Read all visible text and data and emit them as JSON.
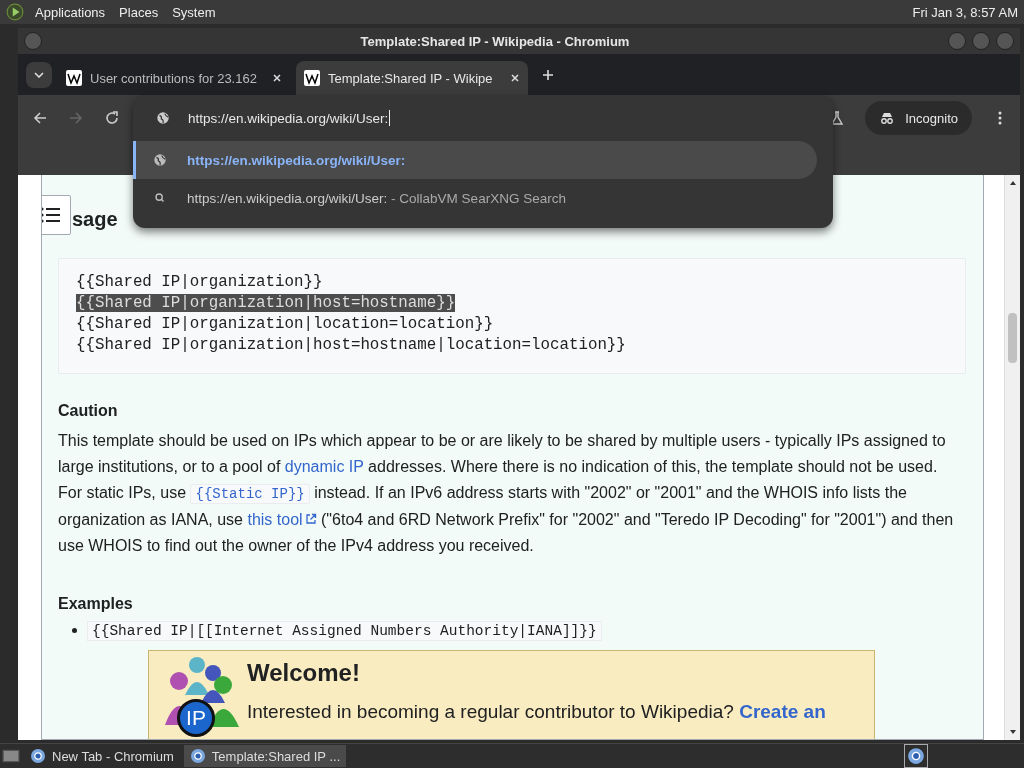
{
  "top_panel": {
    "menus": [
      "Applications",
      "Places",
      "System"
    ],
    "clock": "Fri Jan  3,  8:57 AM"
  },
  "window": {
    "title": "Template:Shared IP - Wikipedia - Chromium"
  },
  "tabs": [
    {
      "label": "User contributions for 23.162",
      "selected": false
    },
    {
      "label": "Template:Shared IP - Wikipe",
      "selected": true
    }
  ],
  "address_bar": {
    "value": "https://en.wikipedia.org/wiki/User:"
  },
  "incognito": "Incognito",
  "suggestions": [
    {
      "kind": "url",
      "text": "https://en.wikipedia.org/wiki/User:",
      "selected": true
    },
    {
      "kind": "search",
      "text": "https://en.wikipedia.org/wiki/User:",
      "suffix": " - CollabVM SearXNG Search",
      "selected": false
    }
  ],
  "usage_heading": "sage",
  "code_lines": [
    {
      "text": "{{Shared IP|organization}}",
      "selected": false
    },
    {
      "text": "{{Shared IP|organization|host=hostname}}",
      "selected": true
    },
    {
      "text": "{{Shared IP|organization|location=location}}",
      "selected": false
    },
    {
      "text": "{{Shared IP|organization|host=hostname|location=location}}",
      "selected": false
    }
  ],
  "caution_heading": "Caution",
  "caution_paragraph": [
    {
      "kind": "text",
      "text": "This template should be used on IPs which appear to be or are likely to be shared by multiple users - typically IPs assigned to large institutions, or to a pool of "
    },
    {
      "kind": "link",
      "text": "dynamic IP"
    },
    {
      "kind": "text",
      "text": " addresses. Where there is no indication of this, the template should not be used. For static IPs, use "
    },
    {
      "kind": "code",
      "text": "{{Static IP}}"
    },
    {
      "kind": "text",
      "text": " instead. If an IPv6 address starts with \"2002\" or \"2001\" and the WHOIS info lists the organization as IANA, use "
    },
    {
      "kind": "extlink",
      "text": "this tool"
    },
    {
      "kind": "text",
      "text": " (\"6to4 and 6RD Network Prefix\" for \"2002\" and \"Teredo IP Decoding\" for \"2001\") and then use WHOIS to find out the owner of the IPv4 address you received."
    }
  ],
  "examples_heading": "Examples",
  "examples": [
    "{{Shared IP|[[Internet Assigned Numbers Authority|IANA]]}}"
  ],
  "welcome": {
    "badge": "IP",
    "title": "Welcome!",
    "text": "Interested in becoming a regular contributor to Wikipedia? ",
    "link": "Create an"
  },
  "taskbar": [
    {
      "label": "New Tab - Chromium",
      "selected": false
    },
    {
      "label": "Template:Shared IP ...",
      "selected": true
    }
  ]
}
